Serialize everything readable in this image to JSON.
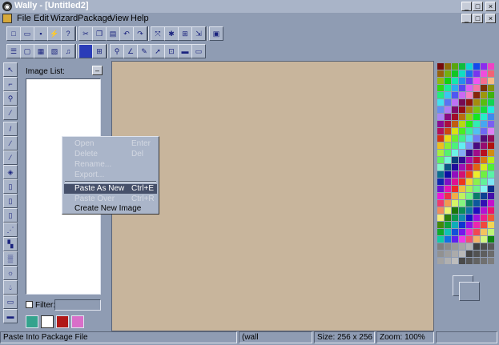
{
  "window": {
    "title": "Wally - [Untitled2]",
    "controls": [
      "_",
      "□",
      "×"
    ],
    "child_controls": [
      "_",
      "□",
      "×"
    ]
  },
  "menu": [
    "File",
    "Edit",
    "Wizard",
    "Package",
    "View",
    "Help"
  ],
  "image_list": {
    "title": "Image List:",
    "filter_label": "Filter:",
    "filter_value": ""
  },
  "context_menu": [
    {
      "label": "Open",
      "shortcut": "Enter",
      "enabled": false,
      "highlighted": false
    },
    {
      "label": "Delete",
      "shortcut": "Del",
      "enabled": false,
      "highlighted": false
    },
    {
      "label": "Rename...",
      "shortcut": "",
      "enabled": false,
      "highlighted": false
    },
    {
      "label": "Export...",
      "shortcut": "",
      "enabled": false,
      "highlighted": false
    },
    {
      "label": "Paste As New",
      "shortcut": "Ctrl+E",
      "enabled": true,
      "highlighted": true
    },
    {
      "label": "Paste Over",
      "shortcut": "Ctrl+R",
      "enabled": false,
      "highlighted": false
    },
    {
      "label": "Create New Image",
      "shortcut": "",
      "enabled": true,
      "highlighted": false
    }
  ],
  "status": {
    "hint": "Paste Into Package File",
    "name": "(wall",
    "size": "Size: 256 x 256",
    "zoom": "Zoom: 100%"
  },
  "colors": {
    "canvas": "#c8b59c",
    "background": "#8f9cb3"
  }
}
